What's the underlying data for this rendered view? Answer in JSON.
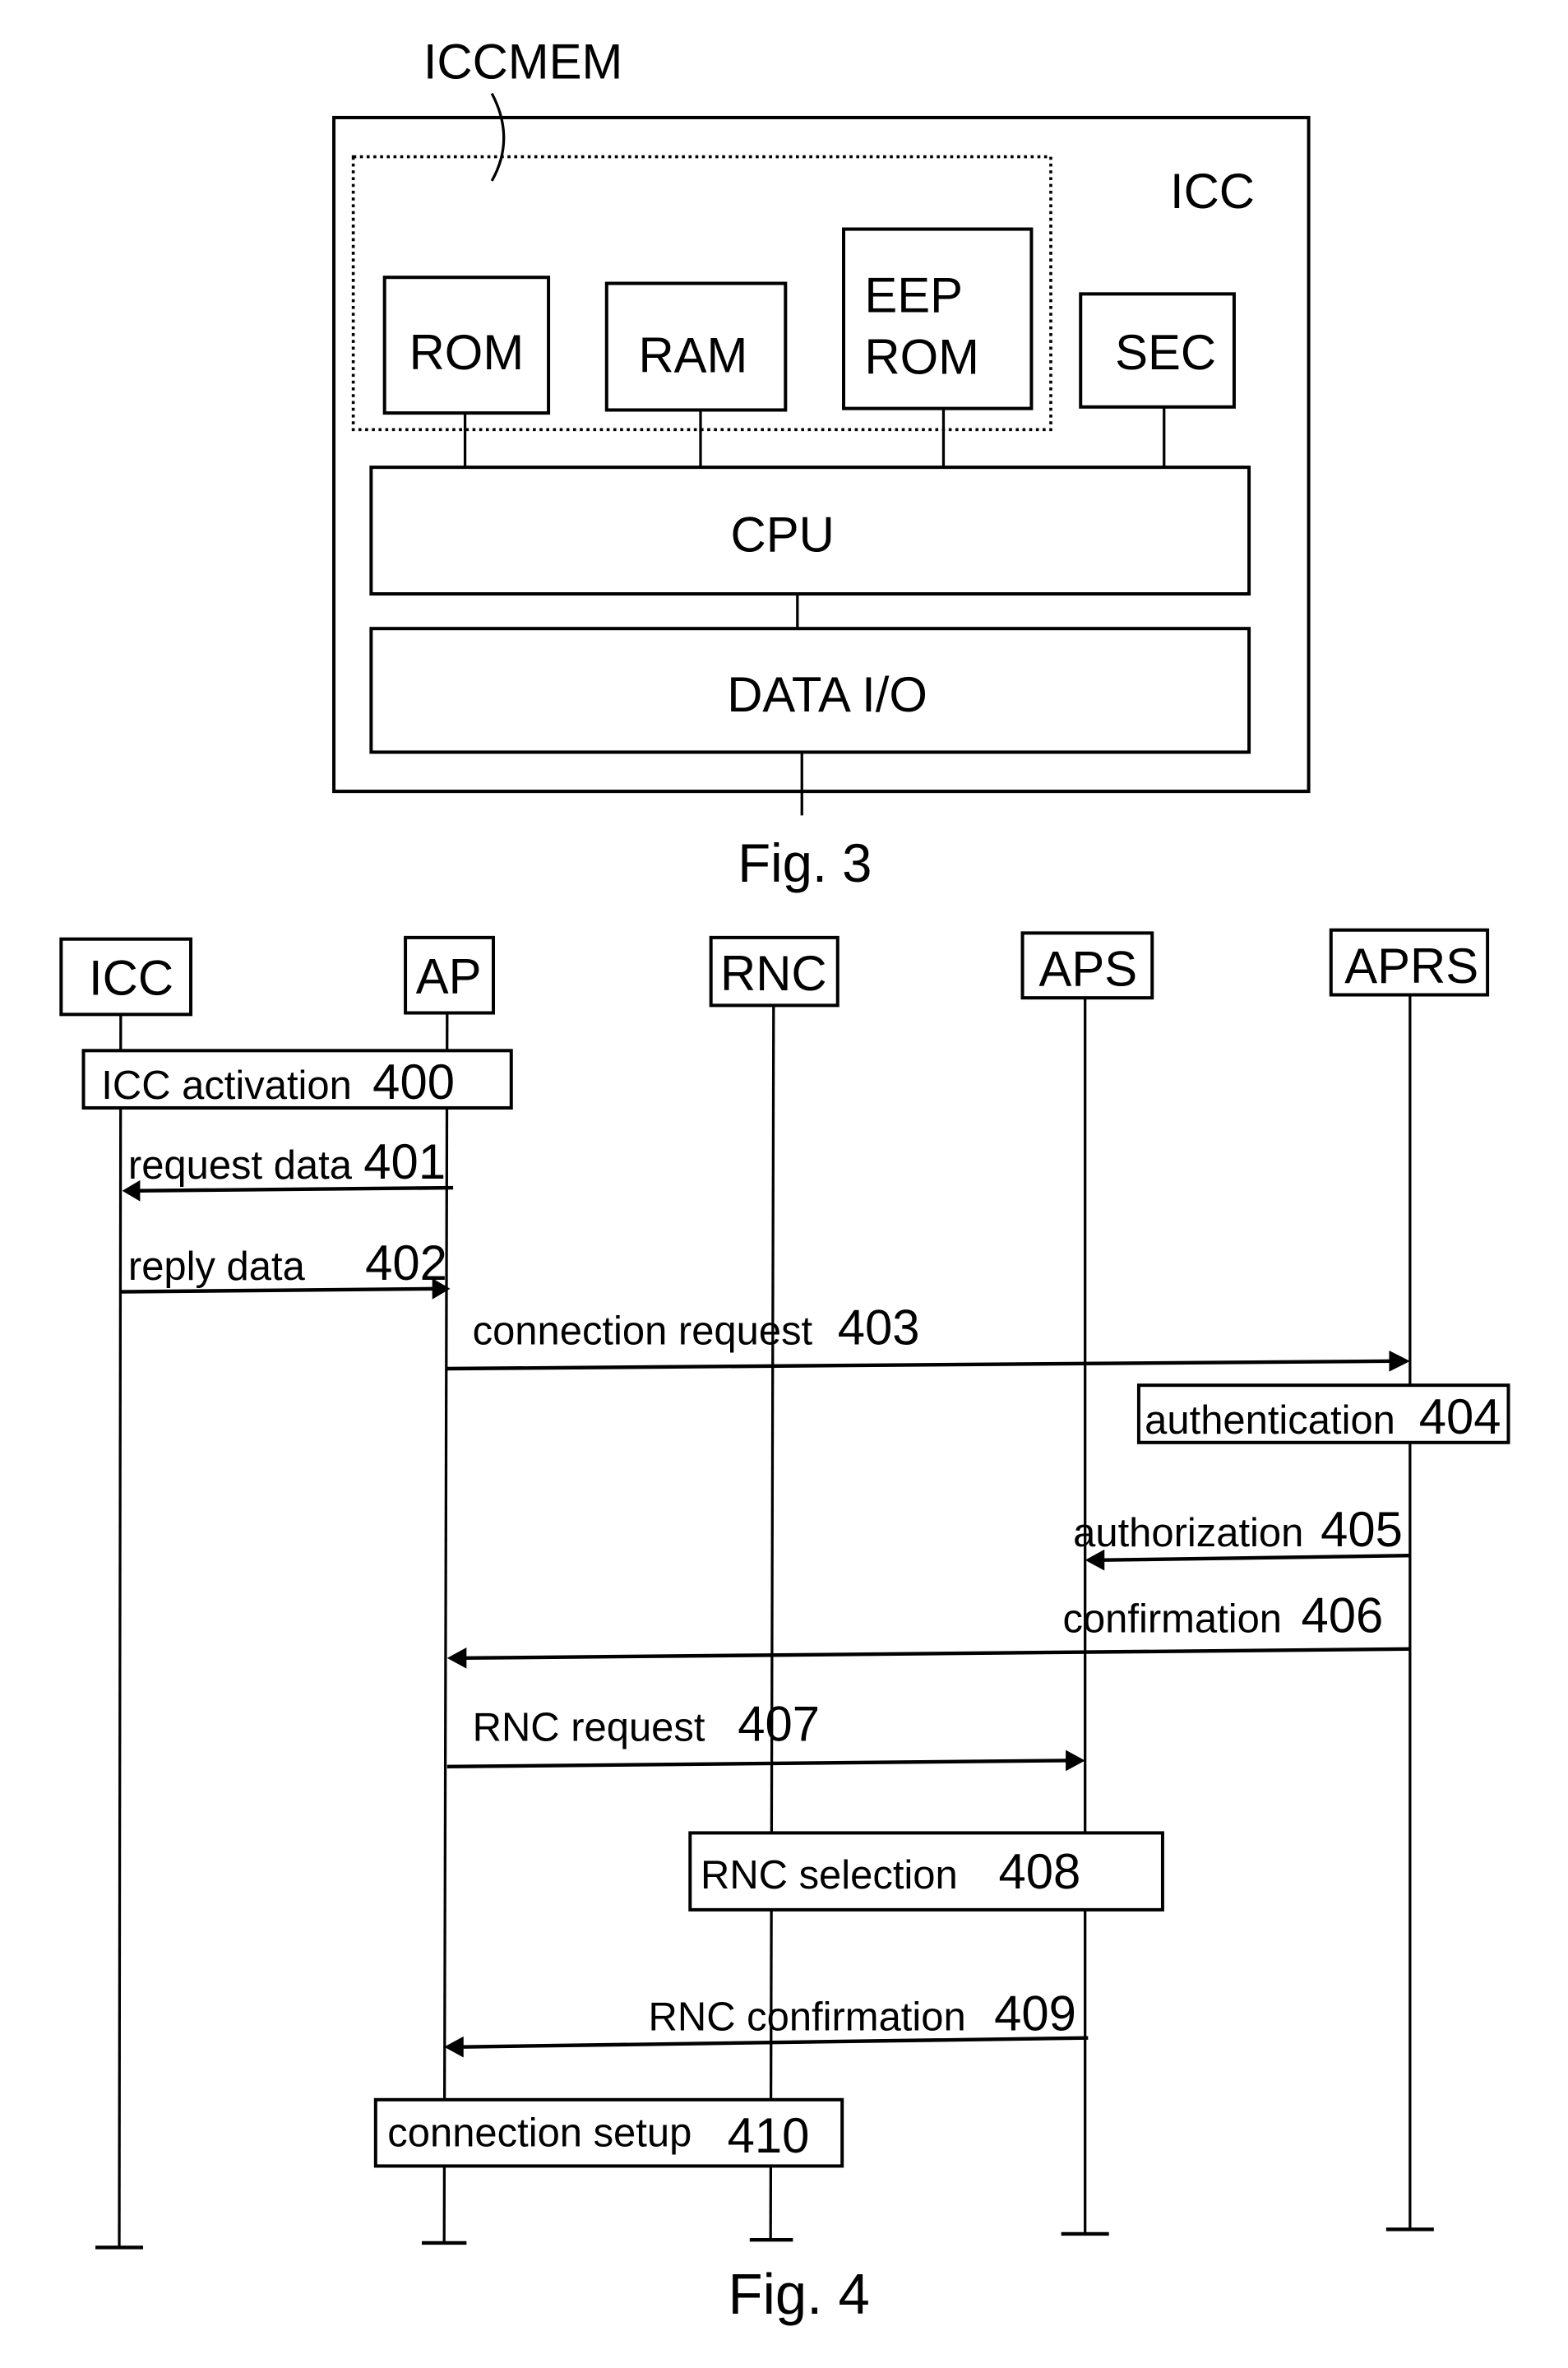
{
  "fig3": {
    "caption": "Fig. 3",
    "container_label": "ICC",
    "memory_group_label": "ICCMEM",
    "blocks": {
      "rom": "ROM",
      "ram": "RAM",
      "eeprom_line1": "EEP",
      "eeprom_line2": "ROM",
      "sec": "SEC",
      "cpu": "CPU",
      "data_io": "DATA I/O"
    }
  },
  "fig4": {
    "caption": "Fig. 4",
    "participants": [
      "ICC",
      "AP",
      "RNC",
      "APS",
      "APRS"
    ],
    "steps": [
      {
        "id": "400",
        "type": "box",
        "text": "ICC activation",
        "number": "400"
      },
      {
        "id": "401",
        "type": "message",
        "text": "request data",
        "number": "401",
        "from": "AP",
        "to": "ICC"
      },
      {
        "id": "402",
        "type": "message",
        "text": "reply data",
        "number": "402",
        "from": "ICC",
        "to": "AP"
      },
      {
        "id": "403",
        "type": "message",
        "text": "connection request",
        "number": "403",
        "from": "AP",
        "to": "APRS"
      },
      {
        "id": "404",
        "type": "box",
        "text": "authentication",
        "number": "404"
      },
      {
        "id": "405",
        "type": "message",
        "text": "authorization",
        "number": "405",
        "from": "APRS",
        "to": "APS"
      },
      {
        "id": "406",
        "type": "message",
        "text": "confirmation",
        "number": "406",
        "from": "APRS",
        "to": "AP"
      },
      {
        "id": "407",
        "type": "message",
        "text": "RNC request",
        "number": "407",
        "from": "AP",
        "to": "APS"
      },
      {
        "id": "408",
        "type": "box",
        "text": "RNC selection",
        "number": "408"
      },
      {
        "id": "409",
        "type": "message",
        "text": "RNC confirmation",
        "number": "409",
        "from": "APS",
        "to": "AP"
      },
      {
        "id": "410",
        "type": "box",
        "text": "connection setup",
        "number": "410"
      }
    ]
  }
}
